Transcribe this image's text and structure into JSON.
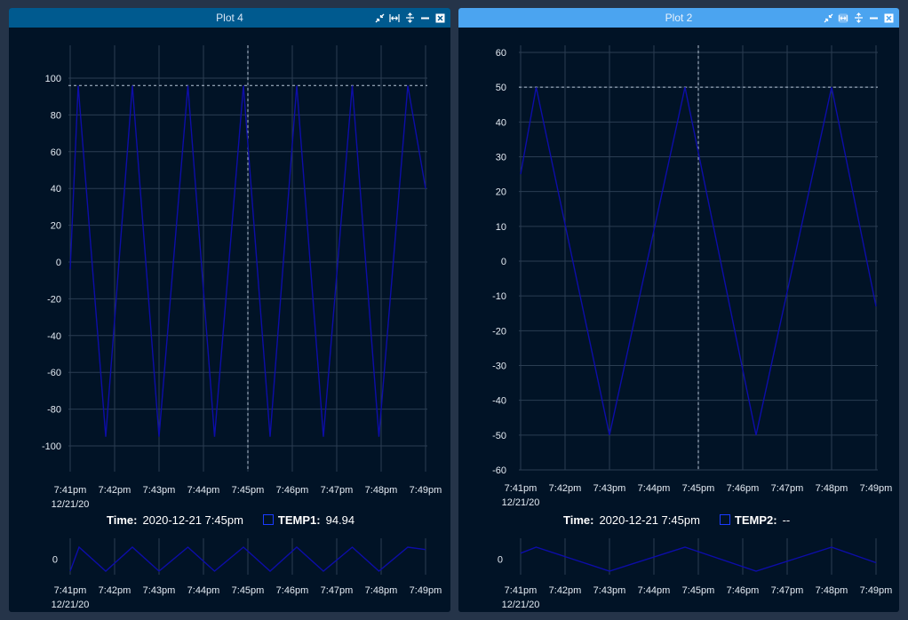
{
  "panels": [
    {
      "title": "Plot 4",
      "legend": {
        "time_label": "Time:",
        "time_value": "2020-12-21 7:45pm",
        "series_label": "TEMP1:",
        "series_value": "94.94"
      }
    },
    {
      "title": "Plot 2",
      "legend": {
        "time_label": "Time:",
        "time_value": "2020-12-21 7:45pm",
        "series_label": "TEMP2:",
        "series_value": "--"
      }
    }
  ],
  "toolbar_icons": [
    "collapse-icon",
    "fit-horizontal-icon",
    "fit-vertical-icon",
    "minimize-icon",
    "close-icon"
  ],
  "colors": {
    "line": "#0d0da8",
    "grid": "#2a3d52",
    "crosshair": "#b8c6d6",
    "tick_text": "#e4ebf3"
  },
  "chart_data": [
    {
      "type": "line",
      "title": "Plot 4",
      "xlabel": "",
      "ylabel": "",
      "x_ticks": [
        "7:41pm",
        "7:42pm",
        "7:43pm",
        "7:44pm",
        "7:45pm",
        "7:46pm",
        "7:47pm",
        "7:48pm",
        "7:49pm"
      ],
      "x_date_label": "12/21/20",
      "y_ticks": [
        100,
        80,
        60,
        40,
        20,
        0,
        -20,
        -40,
        -60,
        -80,
        -100
      ],
      "ylim": [
        -114,
        114
      ],
      "xlim_minutes": [
        0,
        8
      ],
      "grid": true,
      "crosshair": {
        "x_minutes": 4.0,
        "y": 96
      },
      "series": [
        {
          "name": "TEMP1",
          "x_minutes": [
            0,
            0.18,
            0.8,
            1.4,
            2.0,
            2.65,
            3.25,
            3.9,
            4.5,
            5.1,
            5.7,
            6.35,
            6.95,
            7.6,
            8.0
          ],
          "y": [
            -4,
            96,
            -95,
            96,
            -95,
            96,
            -95,
            96,
            -95,
            96,
            -95,
            96,
            -95,
            96,
            40
          ]
        }
      ],
      "overview": {
        "y_ticks": [
          0
        ],
        "x_minutes": [
          0,
          0.2,
          0.8,
          1.4,
          2.0,
          2.65,
          3.25,
          3.9,
          4.5,
          5.1,
          5.7,
          6.35,
          6.95,
          7.6,
          8.0
        ],
        "y": [
          -1,
          1,
          -1,
          1,
          -1,
          1,
          -1,
          1,
          -1,
          1,
          -1,
          1,
          -1,
          1,
          0.8
        ]
      }
    },
    {
      "type": "line",
      "title": "Plot 2",
      "xlabel": "",
      "ylabel": "",
      "x_ticks": [
        "7:41pm",
        "7:42pm",
        "7:43pm",
        "7:44pm",
        "7:45pm",
        "7:46pm",
        "7:47pm",
        "7:48pm",
        "7:49pm"
      ],
      "x_date_label": "12/21/20",
      "y_ticks": [
        60,
        50,
        40,
        30,
        20,
        10,
        0,
        -10,
        -20,
        -30,
        -40,
        -50,
        -60
      ],
      "ylim": [
        -60,
        60
      ],
      "xlim_minutes": [
        0,
        8
      ],
      "grid": true,
      "crosshair": {
        "x_minutes": 4.0,
        "y": 50
      },
      "series": [
        {
          "name": "TEMP2",
          "x_minutes": [
            0,
            0.35,
            2.0,
            3.7,
            5.3,
            7.0,
            8.0
          ],
          "y": [
            25,
            50,
            -50,
            50,
            -50,
            50,
            -13
          ]
        }
      ],
      "overview": {
        "y_ticks": [
          0
        ],
        "x_minutes": [
          0,
          0.35,
          2.0,
          3.7,
          5.3,
          7.0,
          8.0
        ],
        "y": [
          0.5,
          1,
          -1,
          1,
          -1,
          1,
          -0.3
        ]
      }
    }
  ]
}
